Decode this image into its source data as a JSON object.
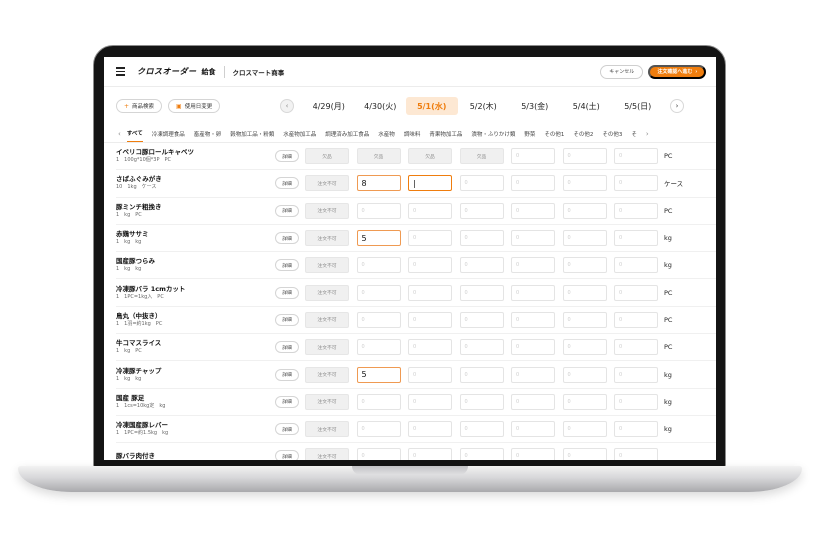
{
  "header": {
    "logo": "クロスオーダー",
    "logo_sub": "給食",
    "company": "クロスマート商事",
    "cancel_label": "キャンセル",
    "confirm_label": "注文確認へ進む",
    "confirm_arrow": "›"
  },
  "toolbar": {
    "search_label": "商品検索",
    "change_date_label": "使用日変更",
    "prev": "‹",
    "next": "›"
  },
  "dates": [
    "4/29(月)",
    "4/30(火)",
    "5/1(水)",
    "5/2(木)",
    "5/3(金)",
    "5/4(土)",
    "5/5(日)"
  ],
  "active_date": "5/1(水)",
  "categories": [
    "すべて",
    "冷凍調理食品",
    "畜産物・卵",
    "穀物加工品・粉類",
    "水産物加工品",
    "調理済み加工食品",
    "水産物",
    "調味料",
    "青果物加工品",
    "漬物・ふりかけ類",
    "野菜",
    "その他1",
    "その他2",
    "その他3",
    "そ"
  ],
  "category_arrows": {
    "left": "‹",
    "right": "›"
  },
  "labels": {
    "detail": "詳細",
    "shortage": "欠品",
    "unavailable": "注文不可",
    "zero": "0"
  },
  "products": [
    {
      "name": "イベリコ豚ロールキャベツ",
      "spec": "1　100g*10個*3P　PC",
      "unit": "PC",
      "cells": [
        "shortage",
        "shortage",
        "shortage",
        "shortage",
        "zero",
        "zero",
        "zero"
      ],
      "values": [
        "",
        "",
        "",
        "",
        "",
        "",
        ""
      ]
    },
    {
      "name": "さばふぐみがき",
      "spec": "10　1kg　ケース",
      "unit": "ケース",
      "cells": [
        "unavailable",
        "filled",
        "focused",
        "zero",
        "zero",
        "zero",
        "zero"
      ],
      "values": [
        "",
        "8",
        "|",
        "",
        "",
        "",
        ""
      ]
    },
    {
      "name": "豚ミンチ粗挽き",
      "spec": "1　kg　PC",
      "unit": "PC",
      "cells": [
        "unavailable",
        "zero",
        "zero",
        "zero",
        "zero",
        "zero",
        "zero"
      ],
      "values": [
        "",
        "",
        "",
        "",
        "",
        "",
        ""
      ]
    },
    {
      "name": "赤鶏ササミ",
      "spec": "1　kg　kg",
      "unit": "kg",
      "cells": [
        "unavailable",
        "filled",
        "zero",
        "zero",
        "zero",
        "zero",
        "zero"
      ],
      "values": [
        "",
        "5",
        "",
        "",
        "",
        "",
        ""
      ]
    },
    {
      "name": "国産豚つらみ",
      "spec": "1　kg　kg",
      "unit": "kg",
      "cells": [
        "unavailable",
        "zero",
        "zero",
        "zero",
        "zero",
        "zero",
        "zero"
      ],
      "values": [
        "",
        "",
        "",
        "",
        "",
        "",
        ""
      ]
    },
    {
      "name": "冷凍豚バラ 1cmカット",
      "spec": "1　1PC=1kg入　PC",
      "unit": "PC",
      "cells": [
        "unavailable",
        "zero",
        "zero",
        "zero",
        "zero",
        "zero",
        "zero"
      ],
      "values": [
        "",
        "",
        "",
        "",
        "",
        "",
        ""
      ]
    },
    {
      "name": "鳥丸（中抜き）",
      "spec": "1　1羽=約1kg　PC",
      "unit": "PC",
      "cells": [
        "unavailable",
        "zero",
        "zero",
        "zero",
        "zero",
        "zero",
        "zero"
      ],
      "values": [
        "",
        "",
        "",
        "",
        "",
        "",
        ""
      ]
    },
    {
      "name": "牛コマスライス",
      "spec": "1　kg　PC",
      "unit": "PC",
      "cells": [
        "unavailable",
        "zero",
        "zero",
        "zero",
        "zero",
        "zero",
        "zero"
      ],
      "values": [
        "",
        "",
        "",
        "",
        "",
        "",
        ""
      ]
    },
    {
      "name": "冷凍豚チャップ",
      "spec": "1　kg　kg",
      "unit": "kg",
      "cells": [
        "unavailable",
        "filled",
        "zero",
        "zero",
        "zero",
        "zero",
        "zero"
      ],
      "values": [
        "",
        "5",
        "",
        "",
        "",
        "",
        ""
      ]
    },
    {
      "name": "国産 豚足",
      "spec": "1　1cs=10kg定　kg",
      "unit": "kg",
      "cells": [
        "unavailable",
        "zero",
        "zero",
        "zero",
        "zero",
        "zero",
        "zero"
      ],
      "values": [
        "",
        "",
        "",
        "",
        "",
        "",
        ""
      ]
    },
    {
      "name": "冷凍国産豚レバー",
      "spec": "1　1PC=約1.5kg　kg",
      "unit": "kg",
      "cells": [
        "unavailable",
        "zero",
        "zero",
        "zero",
        "zero",
        "zero",
        "zero"
      ],
      "values": [
        "",
        "",
        "",
        "",
        "",
        "",
        ""
      ]
    },
    {
      "name": "豚バラ肉付き",
      "spec": "",
      "unit": "",
      "cells": [
        "unavailable",
        "zero",
        "zero",
        "zero",
        "zero",
        "zero",
        "zero"
      ],
      "values": [
        "",
        "",
        "",
        "",
        "",
        "",
        ""
      ]
    }
  ]
}
